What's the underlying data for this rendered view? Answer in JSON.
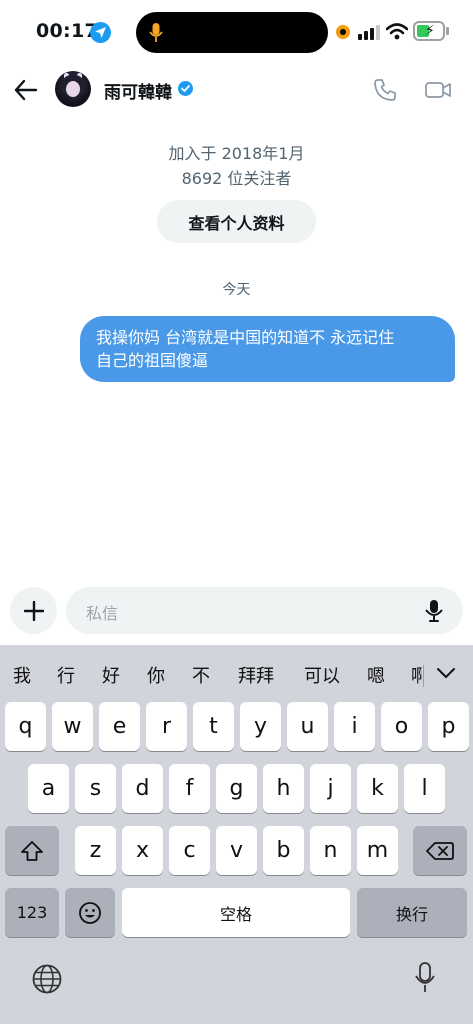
{
  "status_bar": {
    "time": "00:17"
  },
  "header": {
    "name": "雨可韓韓"
  },
  "profile_summary": {
    "joined": "加入于 2018年1月",
    "followers": "8692 位关注者",
    "view_profile_label": "查看个人资料"
  },
  "conversation": {
    "date_separator": "今天",
    "messages": [
      {
        "line1": "我操你妈 台湾就是中国的知道不 永远记住",
        "line2": "自己的祖国傻逼"
      }
    ]
  },
  "composer": {
    "placeholder": "私信"
  },
  "keyboard": {
    "candidates": [
      "我",
      "行",
      "好",
      "你",
      "不",
      "拜拜",
      "可以",
      "嗯",
      "啊"
    ],
    "row1": [
      "q",
      "w",
      "e",
      "r",
      "t",
      "y",
      "u",
      "i",
      "o",
      "p"
    ],
    "row2": [
      "a",
      "s",
      "d",
      "f",
      "g",
      "h",
      "j",
      "k",
      "l"
    ],
    "row3": [
      "z",
      "x",
      "c",
      "v",
      "b",
      "n",
      "m"
    ],
    "numbers_label": "123",
    "space_label": "空格",
    "return_label": "换行"
  },
  "colors": {
    "accent": "#1d9bf0",
    "bubble": "#4a99e9",
    "keyboard_bg": "#d1d4db"
  }
}
